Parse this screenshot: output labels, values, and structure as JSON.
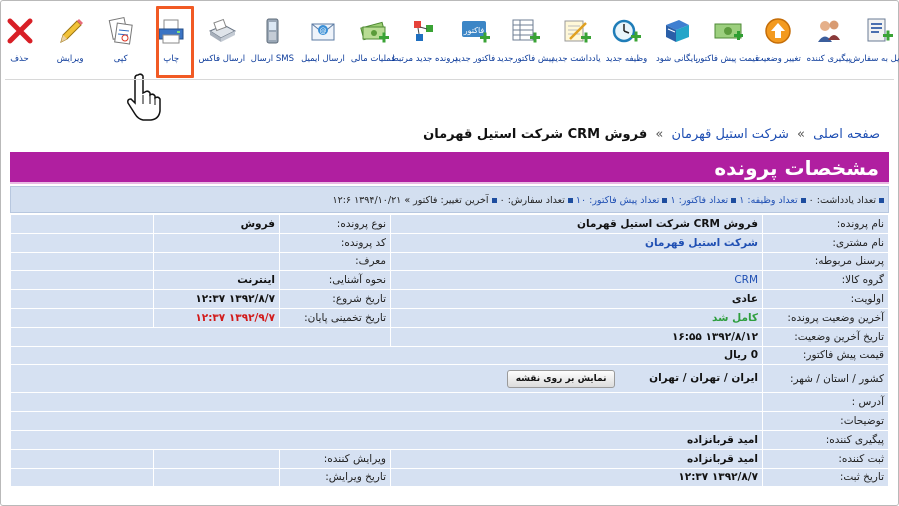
{
  "toolbar": {
    "items": [
      {
        "label": "تبدیل به سفارش",
        "icon": "convert-order-icon"
      },
      {
        "label": "پیگیری کننده",
        "icon": "follow-up-icon"
      },
      {
        "label": "تغییر وضعیت",
        "icon": "change-status-icon"
      },
      {
        "label": "قیمت پیش فاکتور",
        "icon": "proforma-price-icon"
      },
      {
        "label": "بایگانی شود",
        "icon": "archive-icon"
      },
      {
        "label": "وظیفه جدید",
        "icon": "new-task-icon"
      },
      {
        "label": "یادداشت جدید",
        "icon": "new-note-icon"
      },
      {
        "label": "پیش فاکتورجدید",
        "icon": "new-proforma-icon"
      },
      {
        "label": "فاکتور جدید",
        "icon": "new-invoice-icon"
      },
      {
        "label": "پرونده جدید مرتبط",
        "icon": "new-related-case-icon"
      },
      {
        "label": "عملیات مالی",
        "icon": "financial-icon"
      },
      {
        "label": "ارسال ایمیل",
        "icon": "email-icon"
      },
      {
        "label": "ارسال SMS",
        "icon": "sms-icon"
      },
      {
        "label": "ارسال فاکس",
        "icon": "fax-icon"
      },
      {
        "label": "چاپ",
        "icon": "print-icon"
      },
      {
        "label": "کپی",
        "icon": "copy-icon"
      },
      {
        "label": "ویرایش",
        "icon": "edit-icon"
      },
      {
        "label": "حذف",
        "icon": "delete-icon"
      }
    ]
  },
  "breadcrumb": {
    "home": "صفحه اصلی",
    "customer": "شرکت استیل قهرمان",
    "sep": "»",
    "current": "فروش CRM شرکت استیل قهرمان"
  },
  "header": {
    "title": "مشخصات پرونده"
  },
  "stats": {
    "notes": "تعداد یادداشت: ۰",
    "tasks": "تعداد وظیفه: ۱",
    "invoices": "تعداد فاکتور: ۱",
    "proformas": "تعداد پیش فاکتور: ۱۰",
    "orders": "تعداد سفارش: ۰",
    "last_change": "آخرین تغییر: فاکتور » ۱۳۹۴/۱۰/۲۱ ۱۲:۶"
  },
  "fields": {
    "case_name_label": "نام پرونده:",
    "case_name": "فروش CRM شرکت استیل قهرمان",
    "case_type_label": "نوع پرونده:",
    "case_type": "فروش",
    "customer_label": "نام مشتری:",
    "customer": "شرکت استیل قهرمان",
    "case_code_label": "کد پرونده:",
    "case_code": "",
    "staff_label": "پرسنل مربوطه:",
    "staff": "",
    "referrer_label": "معرف:",
    "referrer": "",
    "product_group_label": "گروه کالا:",
    "product_group": "CRM",
    "acquaint_label": "نحوه آشنایی:",
    "acquaint": "اینترنت",
    "priority_label": "اولویت:",
    "priority": "عادی",
    "start_date_label": "تاریخ شروع:",
    "start_date": "۱۳۹۲/۸/۷ ۱۲:۳۷",
    "last_status_label": "آخرین وضعیت پرونده:",
    "last_status": "کامل شد",
    "est_end_label": "تاریخ تخمینی پایان:",
    "est_end": "۱۳۹۲/۹/۷ ۱۲:۳۷",
    "last_status_date_label": "تاریخ آخرین وضعیت:",
    "last_status_date": "۱۳۹۲/۸/۱۲ ۱۶:۵۵",
    "proforma_price_label": "قیمت پیش فاکتور:",
    "proforma_price": "0 ریال",
    "location_label": "کشور / استان / شهر:",
    "location": "ایران / تهران / تهران",
    "map_button": "نمایش بر روی نقشه",
    "address_label": "آدرس :",
    "address": "",
    "description_label": "توضیحات:",
    "description": "",
    "follower_label": "پیگیری کننده:",
    "follower": "امید قربانزاده",
    "creator_label": "ثبت کننده:",
    "creator": "امید قربانزاده",
    "editor_label": "ویرایش کننده:",
    "editor": "",
    "created_date_label": "تاریخ ثبت:",
    "created_date": "۱۳۹۲/۸/۷ ۱۲:۳۷",
    "edit_date_label": "تاریخ ویرایش:",
    "edit_date": ""
  }
}
